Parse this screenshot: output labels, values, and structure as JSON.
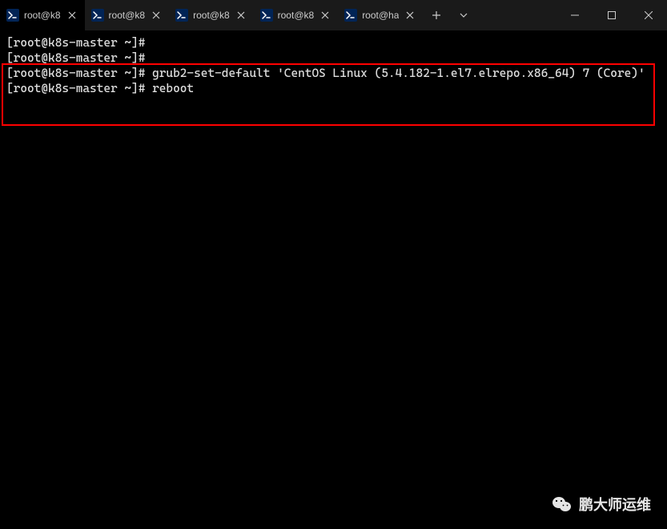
{
  "tabs": [
    {
      "title": "root@k8",
      "active": true
    },
    {
      "title": "root@k8",
      "active": false
    },
    {
      "title": "root@k8",
      "active": false
    },
    {
      "title": "root@k8",
      "active": false
    },
    {
      "title": "root@ha",
      "active": false
    }
  ],
  "terminal": {
    "lines": [
      {
        "prompt": "[root@k8s-master ~]#",
        "command": ""
      },
      {
        "prompt": "[root@k8s-master ~]#",
        "command": ""
      },
      {
        "prompt": "[root@k8s-master ~]#",
        "command": "grub2-set-default 'CentOS Linux (5.4.182-1.el7.elrepo.x86_64) 7 (Core)'"
      },
      {
        "prompt": "[root@k8s-master ~]#",
        "command": "reboot"
      }
    ]
  },
  "watermark": {
    "text": "鹏大师运维"
  }
}
